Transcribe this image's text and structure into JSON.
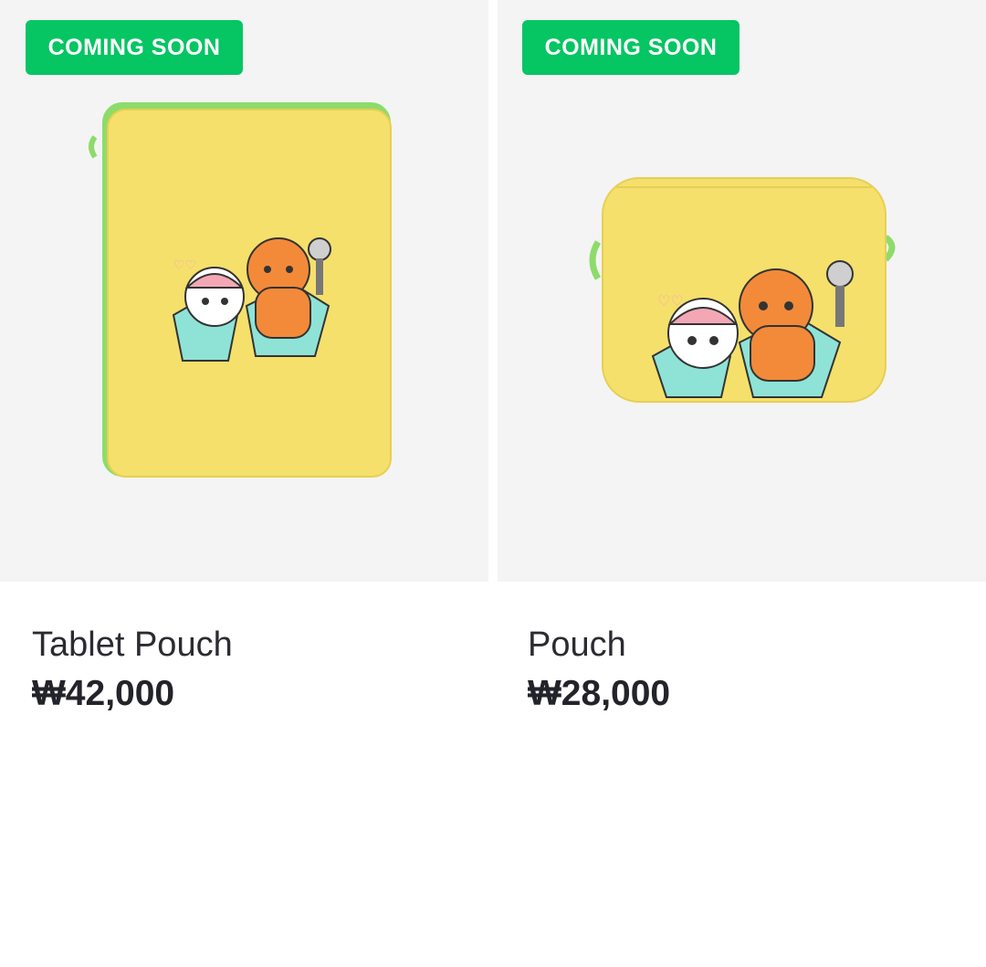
{
  "products": [
    {
      "badge": "COMING SOON",
      "name": "Tablet Pouch",
      "price": "₩42,000",
      "image": "yellow tablet pouch with embroidered characters"
    },
    {
      "badge": "COMING SOON",
      "name": "Pouch",
      "price": "₩28,000",
      "image": "yellow zipper pouch with embroidered characters"
    }
  ],
  "colors": {
    "badge_bg": "#06c563",
    "image_bg": "#f4f4f5",
    "pouch_yellow": "#f5e06c",
    "zipper_green": "#7ed957",
    "text_dark": "#2b2b31"
  }
}
